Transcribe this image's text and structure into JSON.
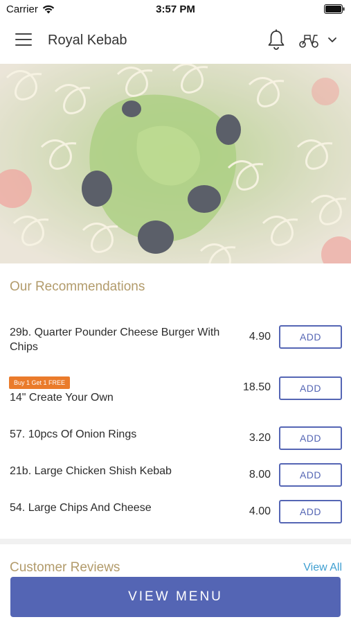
{
  "status_bar": {
    "carrier": "Carrier",
    "time": "3:57 PM"
  },
  "header": {
    "title": "Royal Kebab",
    "icons": [
      "menu-icon",
      "bell-icon",
      "scooter-icon",
      "chevron-down-icon"
    ]
  },
  "recommendations": {
    "title": "Our Recommendations",
    "items": [
      {
        "name": "29b. Quarter Pounder Cheese Burger With Chips",
        "price": "4.90",
        "button": "ADD",
        "badge": ""
      },
      {
        "name": "14\" Create Your Own",
        "price": "18.50",
        "button": "ADD",
        "badge": "Buy 1 Get 1 FREE"
      },
      {
        "name": "57. 10pcs Of Onion Rings",
        "price": "3.20",
        "button": "ADD",
        "badge": ""
      },
      {
        "name": "21b. Large Chicken Shish Kebab",
        "price": "8.00",
        "button": "ADD",
        "badge": ""
      },
      {
        "name": "54. Large Chips And Cheese",
        "price": "4.00",
        "button": "ADD",
        "badge": ""
      }
    ]
  },
  "reviews": {
    "title": "Customer Reviews",
    "view_all": "View All"
  },
  "bottom": {
    "view_menu": "VIEW MENU"
  },
  "colors": {
    "accent": "#5465b4",
    "section_title": "#b29b6b",
    "badge": "#ea7b2b",
    "link": "#3f9fd1"
  }
}
